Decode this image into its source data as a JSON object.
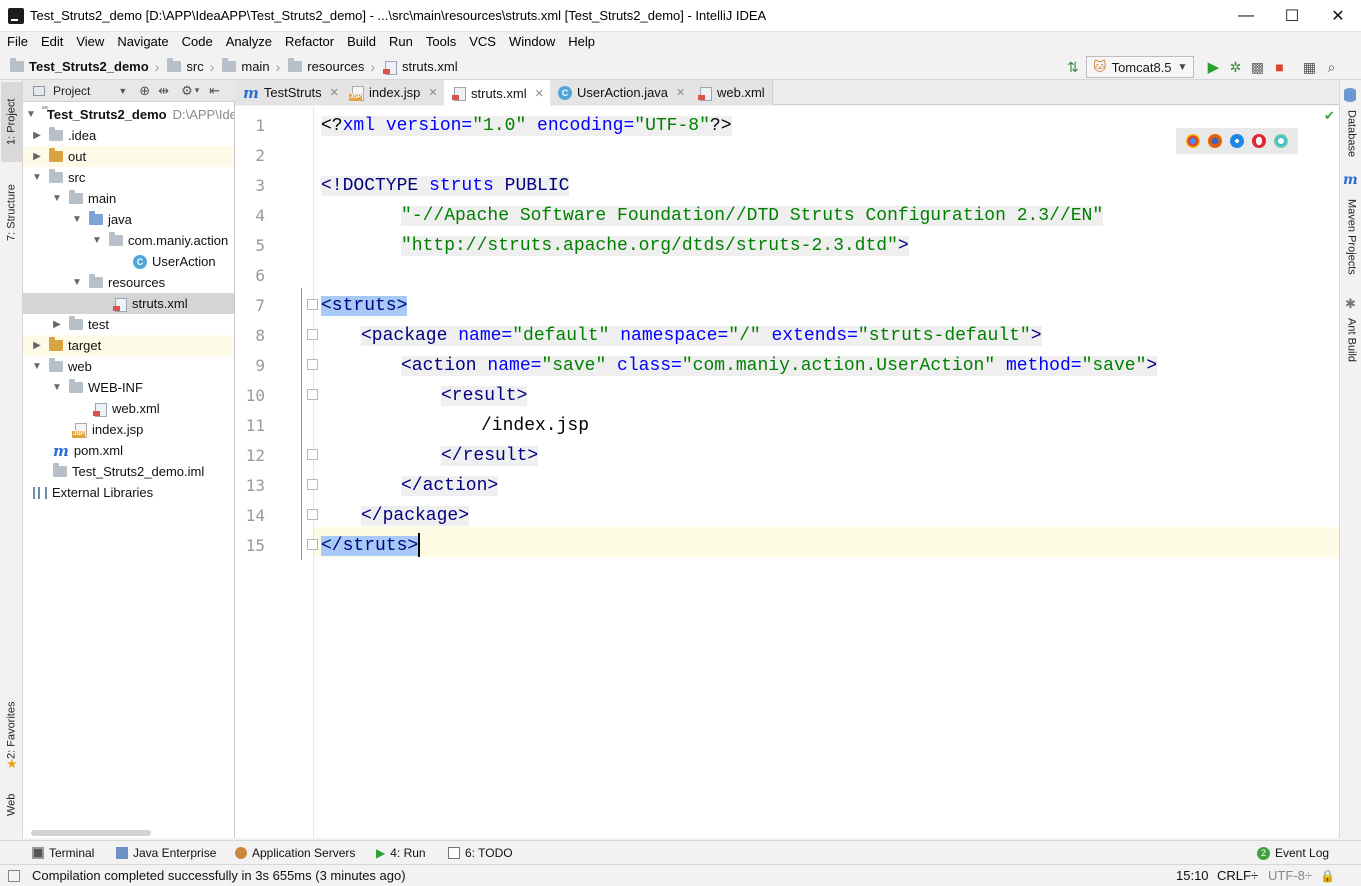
{
  "window": {
    "title": "Test_Struts2_demo [D:\\APP\\IdeaAPP\\Test_Struts2_demo] - ...\\src\\main\\resources\\struts.xml [Test_Struts2_demo] - IntelliJ IDEA",
    "minimize": "—",
    "maximize": "☐",
    "close": "✕"
  },
  "menu": [
    "File",
    "Edit",
    "View",
    "Navigate",
    "Code",
    "Analyze",
    "Refactor",
    "Build",
    "Run",
    "Tools",
    "VCS",
    "Window",
    "Help"
  ],
  "breadcrumbs": [
    "Test_Struts2_demo",
    "src",
    "main",
    "resources",
    "struts.xml"
  ],
  "run_config": "Tomcat8.5",
  "left_stripe": {
    "project": "1: Project",
    "structure": "7: Structure",
    "favorites": "2: Favorites",
    "web": "Web"
  },
  "right_stripe": {
    "database": "Database",
    "maven": "Maven Projects",
    "ant": "Ant Build"
  },
  "project_panel": {
    "header": "Project",
    "tree": [
      {
        "label": "Test_Struts2_demo",
        "path": "D:\\APP\\Idea"
      },
      {
        "label": ".idea"
      },
      {
        "label": "out"
      },
      {
        "label": "src"
      },
      {
        "label": "main"
      },
      {
        "label": "java"
      },
      {
        "label": "com.maniy.action"
      },
      {
        "label": "UserAction"
      },
      {
        "label": "resources"
      },
      {
        "label": "struts.xml"
      },
      {
        "label": "test"
      },
      {
        "label": "target"
      },
      {
        "label": "web"
      },
      {
        "label": "WEB-INF"
      },
      {
        "label": "web.xml"
      },
      {
        "label": "index.jsp"
      },
      {
        "label": "pom.xml"
      },
      {
        "label": "Test_Struts2_demo.iml"
      },
      {
        "label": "External Libraries"
      }
    ]
  },
  "editor_tabs": [
    "TestStruts",
    "index.jsp",
    "struts.xml",
    "UserAction.java",
    "web.xml"
  ],
  "line_numbers": [
    "1",
    "2",
    "3",
    "4",
    "5",
    "6",
    "7",
    "8",
    "9",
    "10",
    "11",
    "12",
    "13",
    "14",
    "15"
  ],
  "code": {
    "l1": {
      "a": "<?",
      "b": "xml version=",
      "c": "\"1.0\"",
      "d": " encoding=",
      "e": "\"UTF-8\"",
      "f": "?>"
    },
    "l3": {
      "a": "<!DOCTYPE ",
      "b": "struts",
      "c": " PUBLIC"
    },
    "l4": {
      "a": "\"-//Apache Software Foundation//DTD Struts Configuration 2.3//EN\""
    },
    "l5": {
      "a": "\"http://struts.apache.org/dtds/struts-2.3.dtd\"",
      "b": ">"
    },
    "l7": {
      "a": "<struts>"
    },
    "l8": {
      "a": "<package ",
      "b": "name=",
      "c": "\"default\"",
      "d": " namespace=",
      "e": "\"/\"",
      "f": " extends=",
      "g": "\"struts-default\"",
      "h": ">"
    },
    "l9": {
      "a": "<action ",
      "b": "name=",
      "c": "\"save\"",
      "d": " class=",
      "e": "\"com.maniy.action.UserAction\"",
      "f": " method=",
      "g": "\"save\"",
      "h": ">"
    },
    "l10": {
      "a": "<result>"
    },
    "l11": {
      "a": "/index.jsp"
    },
    "l12": {
      "a": "</result>"
    },
    "l13": {
      "a": "</action>"
    },
    "l14": {
      "a": "</package>"
    },
    "l15": {
      "a": "</struts>"
    }
  },
  "tool_windows": [
    "Terminal",
    "Java Enterprise",
    "Application Servers",
    "4: Run",
    "6: TODO",
    "Event Log"
  ],
  "event_log_badge": "2",
  "status": {
    "message": "Compilation completed successfully in 3s 655ms (3 minutes ago)",
    "position": "15:10",
    "line_sep": "CRLF÷",
    "encoding": "UTF-8÷"
  },
  "colors": {
    "xml_tag": "#000080",
    "xml_attr": "#0000ff",
    "xml_value": "#008000",
    "selection": "#a6c9f5",
    "current_line": "#fefbe5"
  }
}
